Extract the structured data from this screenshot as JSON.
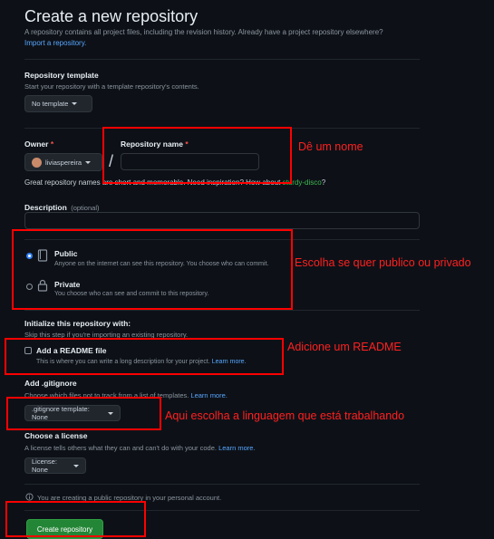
{
  "header": {
    "title": "Create a new repository",
    "description": "A repository contains all project files, including the revision history. Already have a project repository elsewhere?",
    "import_link": "Import a repository."
  },
  "template": {
    "label": "Repository template",
    "hint": "Start your repository with a template repository's contents.",
    "button": "No template"
  },
  "owner": {
    "label": "Owner",
    "required_mark": "*",
    "value": "liviaspereira"
  },
  "separator": "/",
  "repo_name": {
    "label": "Repository name",
    "required_mark": "*",
    "value": ""
  },
  "inspiration": {
    "text": "Great repository names are short and memorable. Need inspiration? How about",
    "suggestion": "sturdy-disco",
    "end": "?"
  },
  "description_field": {
    "label": "Description",
    "optional": "(optional)",
    "value": ""
  },
  "visibility": {
    "public": {
      "title": "Public",
      "hint": "Anyone on the internet can see this repository. You choose who can commit.",
      "selected": true
    },
    "private": {
      "title": "Private",
      "hint": "You choose who can see and commit to this repository.",
      "selected": false
    }
  },
  "init": {
    "title": "Initialize this repository with:",
    "hint": "Skip this step if you're importing an existing repository."
  },
  "readme": {
    "label": "Add a README file",
    "hint": "This is where you can write a long description for your project.",
    "link": "Learn more.",
    "checked": false
  },
  "gitignore": {
    "label": "Add .gitignore",
    "hint": "Choose which files not to track from a list of templates.",
    "link": "Learn more.",
    "button": ".gitignore template: None"
  },
  "license": {
    "label": "Choose a license",
    "hint": "A license tells others what they can and can't do with your code.",
    "link": "Learn more.",
    "button": "License: None"
  },
  "info": {
    "text": "You are creating a public repository in your personal account."
  },
  "submit": {
    "label": "Create repository"
  },
  "annotations": {
    "name": "Dê um nome",
    "visibility": "Escolha se quer publico ou privado",
    "readme": "Adicione um README",
    "gitignore": "Aqui escolha a linguagem que está trabalhando"
  },
  "colors": {
    "background": "#0d1117",
    "accent": "#2f81f7",
    "link": "#58a6ff",
    "success": "#238636",
    "annotation_red": "#ff0000"
  }
}
